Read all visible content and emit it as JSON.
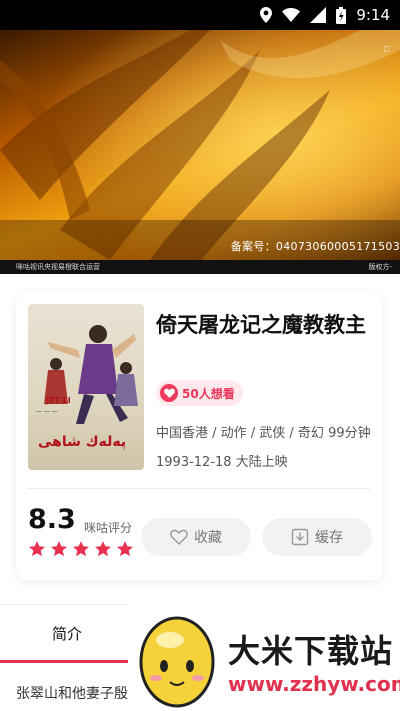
{
  "status_bar": {
    "time": "9:14"
  },
  "video": {
    "record_text": "备案号：04073060005171503",
    "operator_text": "咪咕视讯央视易橙联合运营",
    "copyright_text": "版权方-"
  },
  "movie": {
    "title": "倚天屠龙记之魔教教主",
    "want_count": "50人想看",
    "meta_line1": "中国香港 / 动作 / 武侠 / 奇幻 99分钟",
    "meta_line2": "1993-12-18 大陆上映",
    "score": "8.3",
    "score_label": "咪咕评分",
    "star_count": 5,
    "poster": {
      "name": "JET LI",
      "arabic": "پەلەك شاھى"
    }
  },
  "actions": {
    "favorite": "收藏",
    "cache": "缓存"
  },
  "tabs": {
    "intro": "简介"
  },
  "intro_text": "张翠山和他妻子殷",
  "watermark": {
    "title": "大米下载站",
    "url": "www.zzhyw.com"
  },
  "colors": {
    "accent": "#e0324f",
    "star": "#e8304e",
    "badge_bg": "#ffe9ed"
  }
}
